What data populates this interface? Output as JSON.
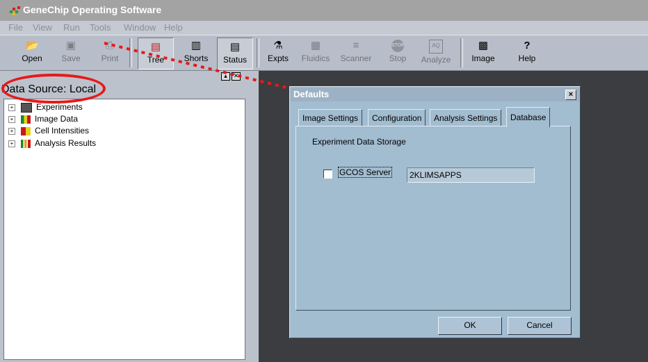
{
  "window": {
    "title": "GeneChip Operating Software"
  },
  "menu": [
    {
      "label": "File"
    },
    {
      "label": "View"
    },
    {
      "label": "Run"
    },
    {
      "label": "Tools"
    },
    {
      "label": "Window"
    },
    {
      "label": "Help"
    }
  ],
  "toolbar": {
    "open": "Open",
    "save": "Save",
    "print": "Print",
    "tree": "Tree",
    "shorts": "Shorts",
    "status": "Status",
    "expts": "Expts",
    "fluidics": "Fluidics",
    "scanner": "Scanner",
    "stop": "Stop",
    "analyze": "Analyze",
    "image": "Image",
    "help": "Help",
    "stop_badge": "STOP",
    "analyze_badge": "AQ"
  },
  "left_pane": {
    "data_source": "Data Source: Local",
    "tree": [
      {
        "label": "Experiments",
        "icon": "experiments-icon"
      },
      {
        "label": "Image Data",
        "icon": "image-data-icon"
      },
      {
        "label": "Cell Intensities",
        "icon": "cell-intensities-icon"
      },
      {
        "label": "Analysis Results",
        "icon": "analysis-results-icon"
      }
    ]
  },
  "dialog": {
    "title": "Defaults",
    "close": "×",
    "tabs": [
      {
        "label": "Image Settings"
      },
      {
        "label": "Configuration"
      },
      {
        "label": "Analysis Settings"
      },
      {
        "label": "Database",
        "active": true
      }
    ],
    "group_label": "Experiment Data Storage",
    "gcos_checkbox_label": "GCOS Server",
    "gcos_checked": false,
    "gcos_server_value": "2KLIMSAPPS",
    "ok_label": "OK",
    "cancel_label": "Cancel"
  },
  "colors": {
    "annotation": "#e51a1a",
    "dialog_bg": "#a2bcd0",
    "main_bg": "#3c3d41"
  }
}
